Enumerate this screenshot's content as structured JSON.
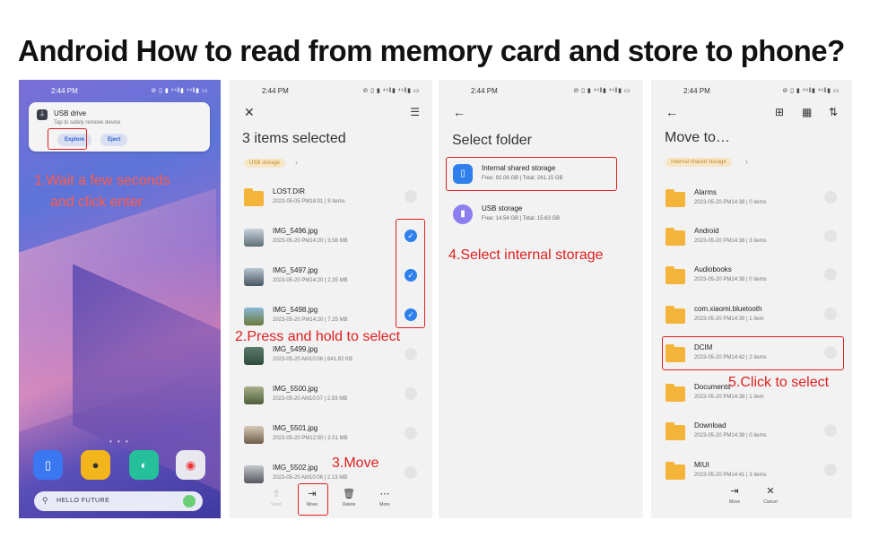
{
  "page_title": "Android How to read from memory card and store to phone?",
  "colors": {
    "annotation_red": "#e02020",
    "accent_blue": "#2f80ed",
    "folder_yellow": "#f4b43a"
  },
  "panel1": {
    "status_time": "2:44 PM",
    "status_icons": "⊘ ▯ ▮ ⁴⁶‖▮ ⁴⁶‖▮ ▭",
    "notification": {
      "title": "USB drive",
      "subtitle": "Tap to safely remove device",
      "explore": "Explore",
      "eject": "Eject"
    },
    "note_line1": "1.Wait a few seconds",
    "note_line2": "and click enter",
    "dots": "• • •",
    "search_text": "HELLO  FUTURE"
  },
  "panel2": {
    "status_time": "2:44 PM",
    "status_icons": "⊘ ▯ ▮ ⁴⁶‖▮ ⁴⁶‖▮ ▭",
    "title": "3 items selected",
    "chip": "USB storage",
    "rows": [
      {
        "name": "LOST.DIR",
        "meta": "2023-05-05 PM18:01  |  8 items",
        "checked": false
      },
      {
        "name": "IMG_5496.jpg",
        "meta": "2023-05-20 PM14:20  |  3.56 MB",
        "checked": true
      },
      {
        "name": "IMG_5497.jpg",
        "meta": "2023-05-20 PM14:20  |  2.35 MB",
        "checked": true
      },
      {
        "name": "IMG_5498.jpg",
        "meta": "2023-05-20 PM14:20  |  7.25 MB",
        "checked": true
      },
      {
        "name": "IMG_5499.jpg",
        "meta": "2023-05-20 AM10:06  |  841.82 KB",
        "checked": false
      },
      {
        "name": "IMG_5500.jpg",
        "meta": "2023-05-20 AM10:07  |  2.93 MB",
        "checked": false
      },
      {
        "name": "IMG_5501.jpg",
        "meta": "2023-05-20 PM12:50  |  2.01 MB",
        "checked": false
      },
      {
        "name": "IMG_5502.jpg",
        "meta": "2023-05-20 AM10:06  |  2.13 MB",
        "checked": false
      }
    ],
    "note_press": "2.Press and hold to select",
    "note_move": "3.Move",
    "bottom": [
      "Send",
      "Move",
      "Delete",
      "More"
    ]
  },
  "panel3": {
    "status_time": "2:44 PM",
    "status_icons": "⊘ ▯ ▮ ⁴⁶‖▮ ⁴⁶‖▮ ▭",
    "title": "Select folder",
    "internal": {
      "name": "Internal shared storage",
      "meta": "Free: 92.06 GB  |  Total: 241.15 GB"
    },
    "usb": {
      "name": "USB storage",
      "meta": "Free: 14.54 GB  |  Total: 15.63 GB"
    },
    "note": "4.Select internal storage"
  },
  "panel4": {
    "status_time": "2:44 PM",
    "status_icons": "⊘ ▯ ▮ ⁴⁶‖▮ ⁴⁶‖▮ ▭",
    "title": "Move to…",
    "chip": "Internal shared storage",
    "rows": [
      {
        "name": "Alarms",
        "meta": "2023-05-20 PM14:38  |  0 items"
      },
      {
        "name": "Android",
        "meta": "2023-05-20 PM14:38  |  3 items"
      },
      {
        "name": "Audiobooks",
        "meta": "2023-05-20 PM14:38  |  0 items"
      },
      {
        "name": "com.xiaomi.bluetooth",
        "meta": "2023-05-20 PM14:39  |  1 item"
      },
      {
        "name": "DCIM",
        "meta": "2023-05-20 PM14:42  |  2 items"
      },
      {
        "name": "Documents",
        "meta": "2023-05-20 PM14:38  |  1 item"
      },
      {
        "name": "Download",
        "meta": "2023-05-20 PM14:38  |  0 items"
      },
      {
        "name": "MIUI",
        "meta": "2023-05-20 PM14:41  |  3 items"
      }
    ],
    "note": "5.Click to select",
    "bottom": [
      "Move",
      "Cancel"
    ]
  }
}
